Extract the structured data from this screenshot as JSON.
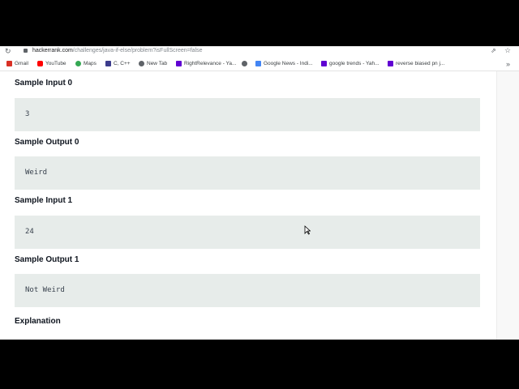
{
  "browser": {
    "url_domain": "hackerrank.com",
    "url_path": "/challenges/java-if-else/problem?isFullScreen=false",
    "bookmarks": [
      {
        "label": "Gmail",
        "icon": "gmail-icon",
        "color": "#d93025"
      },
      {
        "label": "YouTube",
        "icon": "youtube-icon",
        "color": "#ff0000"
      },
      {
        "label": "Maps",
        "icon": "maps-icon",
        "color": "#34a853"
      },
      {
        "label": "C, C++",
        "icon": "cpp-icon",
        "color": "#3c3c8c"
      },
      {
        "label": "New Tab",
        "icon": "globe-icon",
        "color": "#5f6368"
      },
      {
        "label": "RightRelevance - Ya...",
        "icon": "yahoo-icon",
        "color": "#6001d2"
      },
      {
        "label": "",
        "icon": "globe-icon",
        "color": "#5f6368"
      },
      {
        "label": "Google News - Indi...",
        "icon": "google-news-icon",
        "color": "#4285f4"
      },
      {
        "label": "google trends - Yah...",
        "icon": "yahoo-icon",
        "color": "#6001d2"
      },
      {
        "label": "reverse biased pn j...",
        "icon": "yahoo-icon",
        "color": "#6001d2"
      }
    ]
  },
  "problem": {
    "sample_input_0_title": "Sample Input 0",
    "sample_input_0_value": "3",
    "sample_output_0_title": "Sample Output 0",
    "sample_output_0_value": "Weird",
    "sample_input_1_title": "Sample Input 1",
    "sample_input_1_value": "24",
    "sample_output_1_title": "Sample Output 1",
    "sample_output_1_value": "Not Weird",
    "explanation_title": "Explanation"
  },
  "colors": {
    "code_bg": "#e7ecea",
    "heading": "#0e141e"
  }
}
